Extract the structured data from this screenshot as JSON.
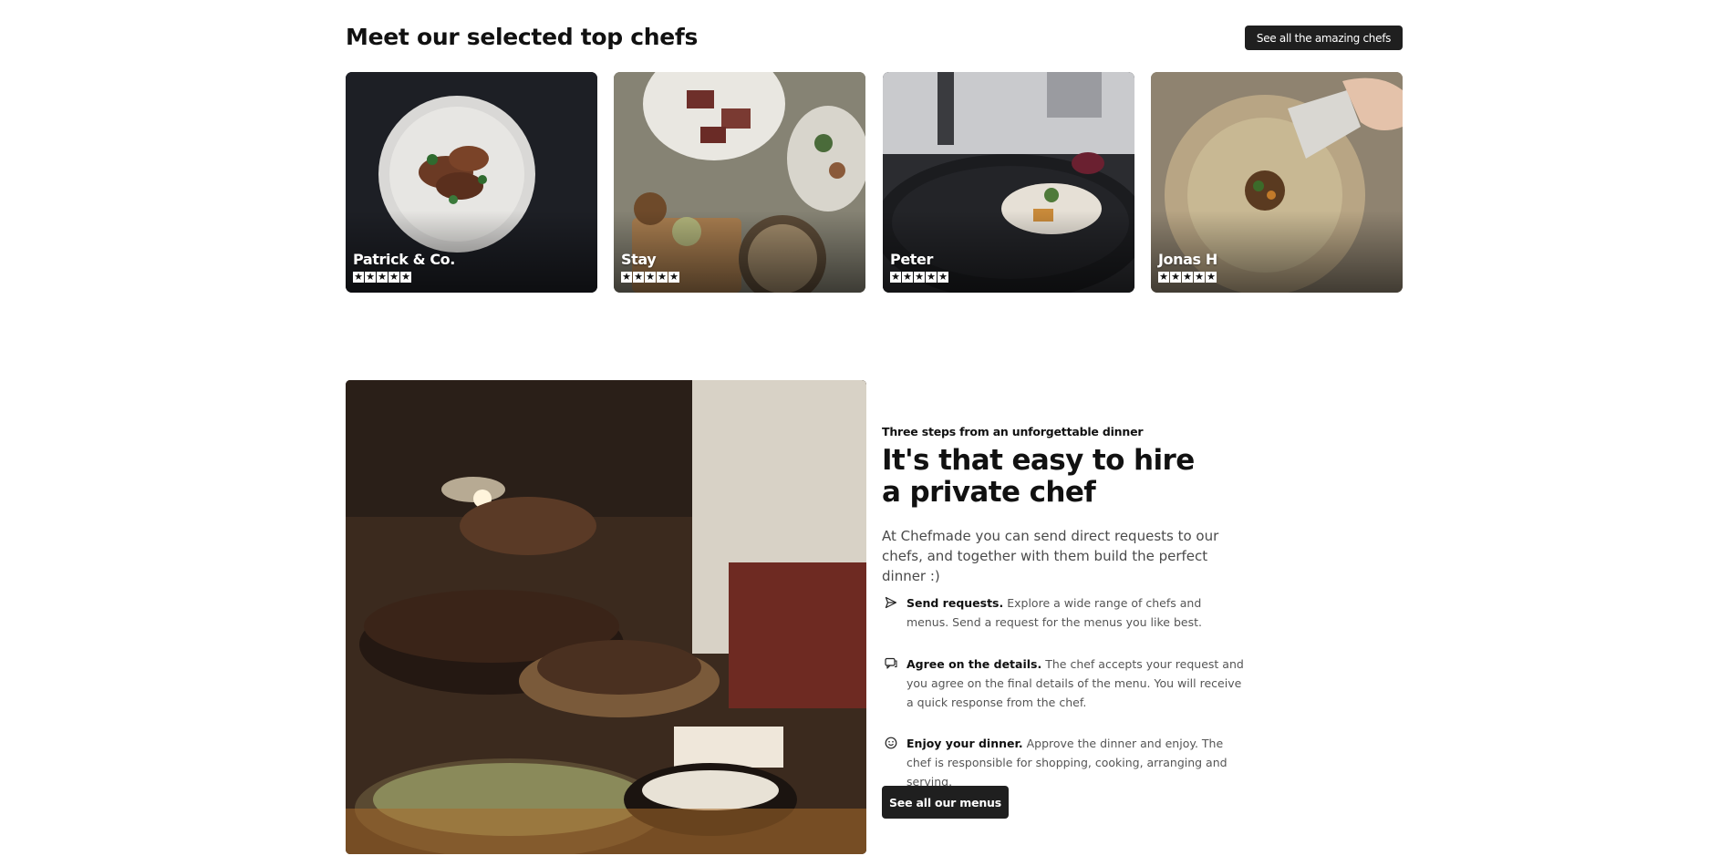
{
  "chefs_section": {
    "title": "Meet our selected top chefs",
    "see_all_label": "See all the amazing chefs",
    "chefs": [
      {
        "name": "Patrick & Co.",
        "rating": 5
      },
      {
        "name": "Stay",
        "rating": 5
      },
      {
        "name": "Peter",
        "rating": 5
      },
      {
        "name": "Jonas H",
        "rating": 5
      }
    ]
  },
  "hire_section": {
    "eyebrow": "Three steps from an unforgettable dinner",
    "title": "It's that easy to hire a private chef",
    "intro": "At Chefmade you can send direct requests to our chefs, and together with them build the perfect dinner :)",
    "steps": [
      {
        "icon": "send-icon",
        "title": "Send requests.",
        "text": "Explore a wide range of chefs and menus. Send a request for the menus you like best."
      },
      {
        "icon": "chat-icon",
        "title": "Agree on the details.",
        "text": "The chef accepts your request and you agree on the final details of the menu. You will receive a quick response from the chef."
      },
      {
        "icon": "smiley-icon",
        "title": "Enjoy your dinner.",
        "text": "Approve the dinner and enjoy. The chef is responsible for shopping, cooking, arranging and serving."
      }
    ],
    "button_label": "See all our menus"
  }
}
